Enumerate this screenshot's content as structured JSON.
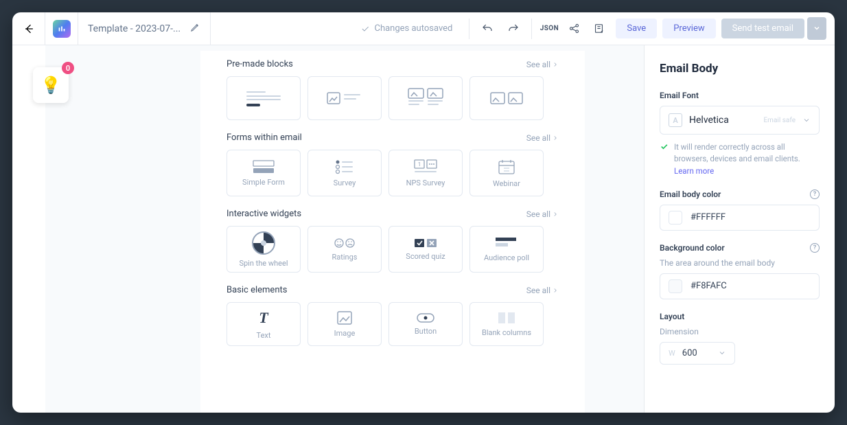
{
  "header": {
    "title": "Template - 2023-07-...",
    "autosave_label": "Changes autosaved",
    "json_label": "JSON",
    "save_label": "Save",
    "preview_label": "Preview",
    "send_label": "Send test email"
  },
  "idea": {
    "badge": "0"
  },
  "canvas": {
    "sections": [
      {
        "title": "Pre-made blocks",
        "see_all": "See all",
        "tiles": [
          {
            "label": ""
          },
          {
            "label": ""
          },
          {
            "label": ""
          },
          {
            "label": ""
          }
        ]
      },
      {
        "title": "Forms within email",
        "see_all": "See all",
        "tiles": [
          {
            "label": "Simple Form"
          },
          {
            "label": "Survey"
          },
          {
            "label": "NPS Survey"
          },
          {
            "label": "Webinar"
          }
        ]
      },
      {
        "title": "Interactive widgets",
        "see_all": "See all",
        "tiles": [
          {
            "label": "Spin the wheel"
          },
          {
            "label": "Ratings"
          },
          {
            "label": "Scored quiz"
          },
          {
            "label": "Audience poll"
          }
        ]
      },
      {
        "title": "Basic elements",
        "see_all": "See all",
        "tiles": [
          {
            "label": "Text"
          },
          {
            "label": "Image"
          },
          {
            "label": "Button"
          },
          {
            "label": "Blank columns"
          }
        ]
      }
    ]
  },
  "panel": {
    "title": "Email Body",
    "font_label": "Email Font",
    "font_value": "Helvetica",
    "font_tag": "Email safe",
    "font_hint": "It will render correctly across all browsers, devices and email clients.",
    "learn_more": "Learn more",
    "body_color_label": "Email body color",
    "body_color_value": "#FFFFFF",
    "bg_color_label": "Background color",
    "bg_color_desc": "The area around the email body",
    "bg_color_value": "#F8FAFC",
    "layout_label": "Layout",
    "dimension_label": "Dimension",
    "dimension_value": "600"
  },
  "colors": {
    "body_swatch": "#FFFFFF",
    "bg_swatch": "#F8FAFC"
  }
}
